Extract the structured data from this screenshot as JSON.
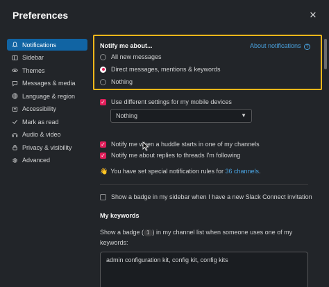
{
  "dialog": {
    "title": "Preferences"
  },
  "sidebar": {
    "items": [
      {
        "label": "Notifications",
        "icon": "bell-icon",
        "active": true
      },
      {
        "label": "Sidebar",
        "icon": "sidebar-icon"
      },
      {
        "label": "Themes",
        "icon": "eye-icon"
      },
      {
        "label": "Messages & media",
        "icon": "message-icon"
      },
      {
        "label": "Language & region",
        "icon": "globe-icon"
      },
      {
        "label": "Accessibility",
        "icon": "accessibility-icon"
      },
      {
        "label": "Mark as read",
        "icon": "check-icon"
      },
      {
        "label": "Audio & video",
        "icon": "headphones-icon"
      },
      {
        "label": "Privacy & visibility",
        "icon": "lock-icon"
      },
      {
        "label": "Advanced",
        "icon": "gear-icon"
      }
    ]
  },
  "notify": {
    "heading": "Notify me about...",
    "about_link": "About notifications",
    "options": [
      {
        "label": "All new messages",
        "selected": false
      },
      {
        "label": "Direct messages, mentions & keywords",
        "selected": true
      },
      {
        "label": "Nothing",
        "selected": false
      }
    ]
  },
  "mobile": {
    "label": "Use different settings for my mobile devices",
    "checked": true,
    "select_value": "Nothing"
  },
  "huddle": {
    "label": "Notify me when a huddle starts in one of my channels",
    "checked": true
  },
  "replies": {
    "label": "Notify me about replies to threads I'm following",
    "checked": true
  },
  "rules": {
    "emoji": "👋",
    "text": "You have set special notification rules for ",
    "link": "36 channels",
    "suffix": "."
  },
  "slack_connect": {
    "label": "Show a badge in my sidebar when I have a new Slack Connect invitation",
    "checked": false
  },
  "keywords": {
    "heading": "My keywords",
    "desc_before": "Show a badge (",
    "badge": "1",
    "desc_after": ") in my channel list when someone uses one of my keywords:",
    "value": "admin configuration kit, config kit, config kits"
  },
  "colors": {
    "accent": "#1164a3",
    "highlight": "#f5b71a",
    "check": "#e01e5a",
    "link": "#4aa3e0"
  }
}
